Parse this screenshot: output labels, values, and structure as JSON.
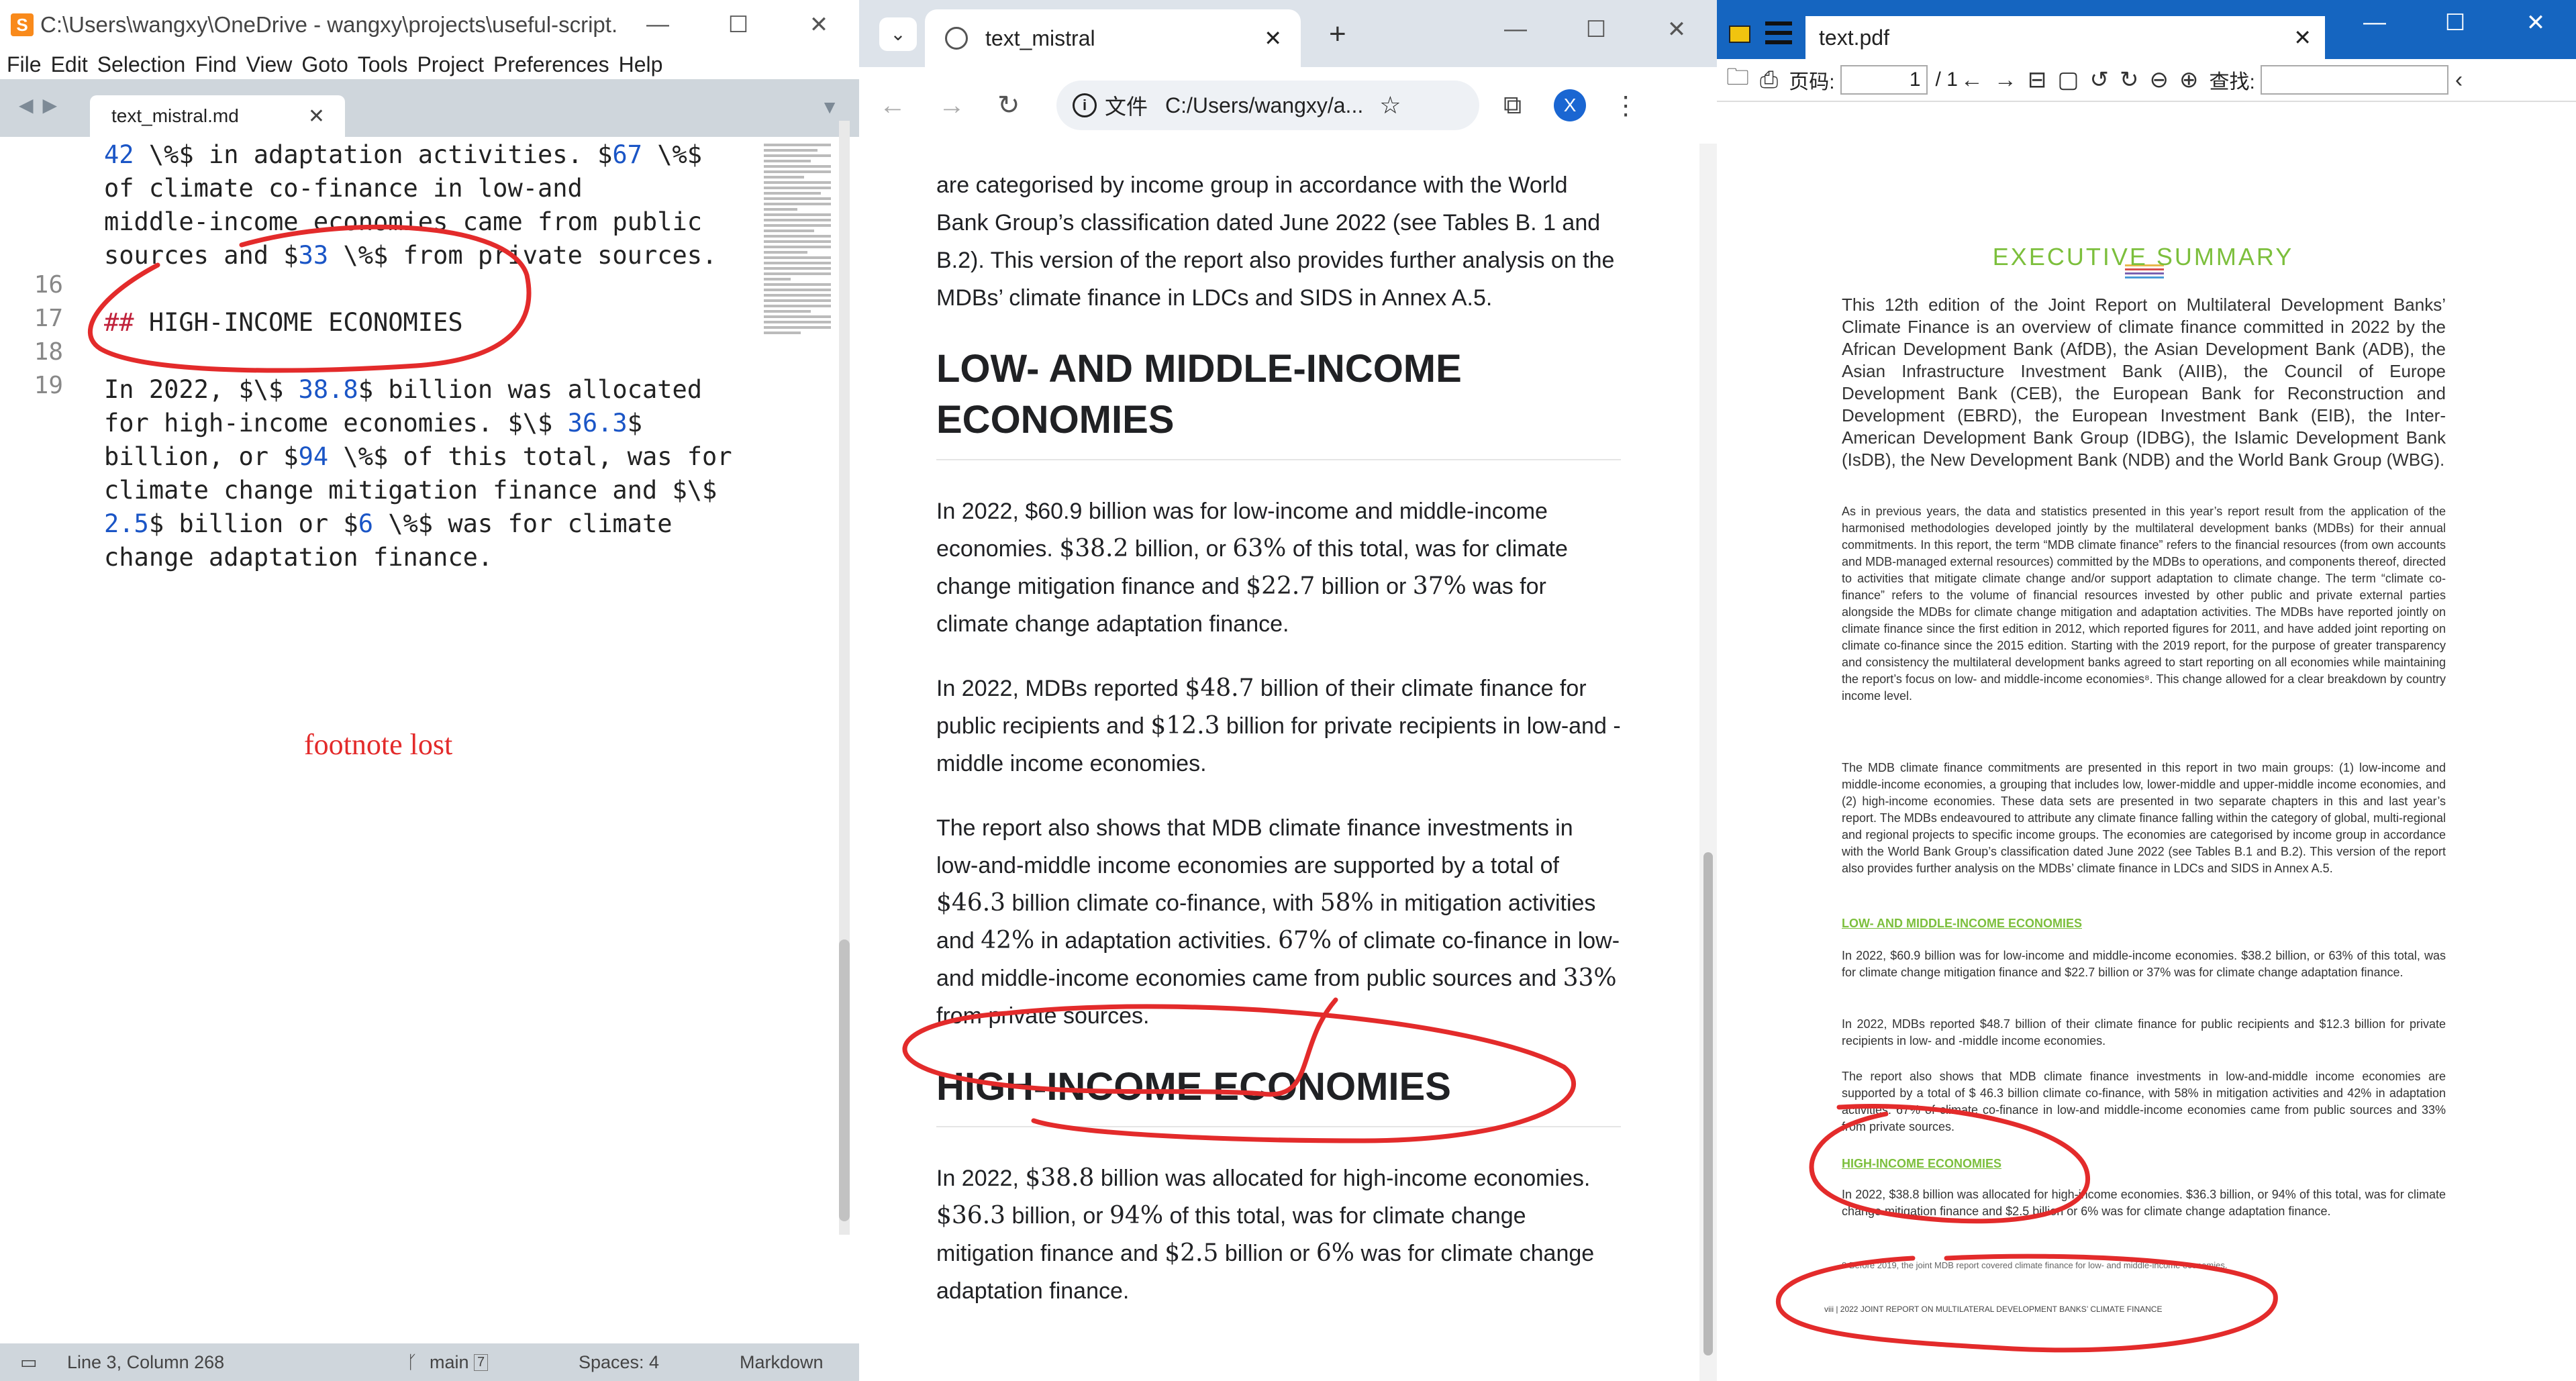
{
  "sublime": {
    "title": "C:\\Users\\wangxy\\OneDrive - wangxy\\projects\\useful-script...",
    "menu": [
      "File",
      "Edit",
      "Selection",
      "Find",
      "View",
      "Goto",
      "Tools",
      "Project",
      "Preferences",
      "Help"
    ],
    "tab": "text_mistral.md",
    "line_numbers": [
      "16",
      "17",
      "18",
      "19"
    ],
    "annotation": "footnote lost",
    "status": {
      "position": "Line 3, Column 268",
      "branch": "main",
      "branch_count": "7",
      "indent": "Spaces: 4",
      "syntax": "Markdown"
    }
  },
  "chrome": {
    "tab_title": "text_mistral",
    "address_prefix": "文件",
    "address": "C:/Users/wangxy/a...",
    "profile": "X",
    "intro": "are categorised by income group in accordance with the World Bank Group’s classification dated June 2022 (see Tables B. 1 and B.2). This version of the report also provides further analysis on the MDBs’ climate finance in LDCs and SIDS in Annex A.5.",
    "h_low": "LOW- AND MIDDLE-INCOME ECONOMIES",
    "h_high": "HIGH-INCOME ECONOMIES"
  },
  "pdf": {
    "tab_title": "text.pdf",
    "page_label": "页码:",
    "page_value": "1",
    "page_total": "/ 1",
    "search_label": "查找:",
    "heading": "EXECUTIVE SUMMARY",
    "p1": "This 12th edition of the Joint Report on Multilateral Development Banks’ Climate Finance is an overview of climate finance committed in 2022 by the African Development Bank (AfDB), the Asian Development Bank (ADB), the Asian Infrastructure Investment Bank (AIIB), the Council of Europe Development Bank (CEB), the European Bank for Reconstruction and Development (EBRD), the European Investment Bank (EIB), the Inter-American Development Bank Group (IDBG), the Islamic Development Bank (IsDB), the New Development Bank (NDB) and the World Bank Group (WBG).",
    "p2": "As in previous years, the data and statistics presented in this year’s report result from the application of the harmonised methodologies developed jointly by the multilateral development banks (MDBs) for their annual commitments. In this report, the term “MDB climate finance” refers to the financial resources (from own accounts and MDB-managed external resources) committed by the MDBs to operations, and components thereof, directed to activities that mitigate climate change and/or support adaptation to climate change. The term “climate co-finance” refers to the volume of financial resources invested by other public and private external parties alongside the MDBs for climate change mitigation and adaptation activities. The MDBs have reported jointly on climate finance since the first edition in 2012, which reported figures for 2011, and have added joint reporting on climate co-finance since the 2015 edition. Starting with the 2019 report, for the purpose of greater transparency and consistency the multilateral development banks agreed to start reporting on all economies while maintaining the report’s focus on low- and middle-income economies⁸. This change allowed for a clear breakdown by country income level.",
    "p3": "The MDB climate finance commitments are presented in this report in two main groups: (1) low-income and middle-income economies, a grouping that includes low, lower-middle and upper-middle income economies, and (2) high-income economies. These data sets are presented in two separate chapters in this and last year’s report. The MDBs endeavoured to attribute any climate finance falling within the category of global, multi-regional and regional projects to specific income groups. The economies are categorised by income group in accordance with the World Bank Group’s classification dated June 2022 (see Tables B.1 and B.2). This version of the report also provides further analysis on the MDBs’ climate finance in LDCs and SIDS in Annex A.5.",
    "sec_low": "LOW- AND MIDDLE-INCOME ECONOMIES",
    "p4": "In 2022, $60.9 billion was for low-income and middle-income economies. $38.2 billion, or 63% of this total, was for climate change mitigation finance and $22.7 billion or 37% was for climate change adaptation finance.",
    "p5": "In 2022, MDBs reported $48.7 billion of their climate finance for public recipients and $12.3 billion for private recipients in low- and -middle income economies.",
    "p6": "The report also shows that MDB climate finance investments in low-and-middle income economies are supported by a total of $ 46.3 billion climate co-finance, with 58% in mitigation activities and 42% in adaptation activities. 67% of climate co-finance in low-and middle-income economies came from public sources and 33% from private sources.",
    "sec_high": "HIGH-INCOME ECONOMIES",
    "p7": "In 2022, $38.8 billion was allocated for high-income economies. $36.3 billion, or 94% of this total, was for climate change mitigation finance and $2.5 billion or 6% was for climate change adaptation finance.",
    "footnote": "8     Before 2019, the joint MDB report covered climate finance for low- and middle-income economies.",
    "footer": "viii   |   2022 JOINT REPORT ON MULTILATERAL DEVELOPMENT BANKS’ CLIMATE FINANCE",
    "colors": {
      "accent": "#7cbf3c",
      "ink": "#e32b2b"
    }
  }
}
